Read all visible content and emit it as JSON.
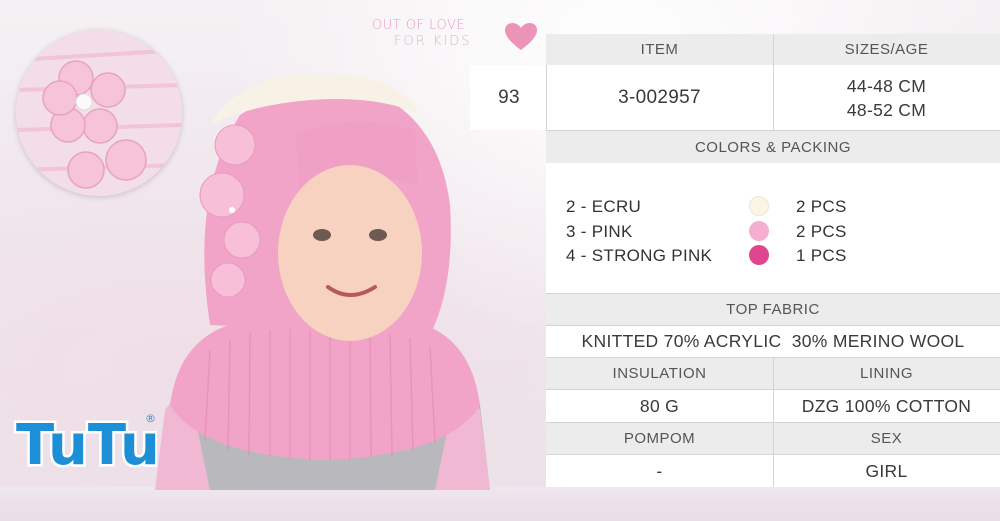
{
  "brand": {
    "tagline_line1": "OUT OF LOVE",
    "tagline_line2": "FOR KIDS",
    "logo_text": "TuTu",
    "logo_mark": "®"
  },
  "item": {
    "header": "ITEM",
    "number": "93",
    "code": "3-002957"
  },
  "sizes": {
    "header": "SIZES/AGE",
    "values": [
      "44-48 CM",
      "48-52 CM"
    ]
  },
  "colors_packing": {
    "header": "COLORS & PACKING",
    "rows": [
      {
        "label": "2 - ECRU",
        "color": "#fbf5e4",
        "qty": "2 PCS"
      },
      {
        "label": "3 - PINK",
        "color": "#f3aed0",
        "qty": "2 PCS"
      },
      {
        "label": "4 - STRONG PINK",
        "color": "#e0468f",
        "qty": "1 PCS"
      }
    ]
  },
  "top_fabric": {
    "header": "TOP FABRIC",
    "value": "KNITTED 70% ACRYLIC  30% MERINO WOOL"
  },
  "insulation": {
    "header": "INSULATION",
    "value": "80 G"
  },
  "lining": {
    "header": "LINING",
    "value": "DZG 100% COTTON"
  },
  "pompom": {
    "header": "POMPOM",
    "value": "-"
  },
  "sex": {
    "header": "SEX",
    "value": "GIRL"
  },
  "palette": {
    "accent_pink": "#e99bbf",
    "hat_pink": "#f2a4c8",
    "logo_blue": "#1c8fd6"
  }
}
